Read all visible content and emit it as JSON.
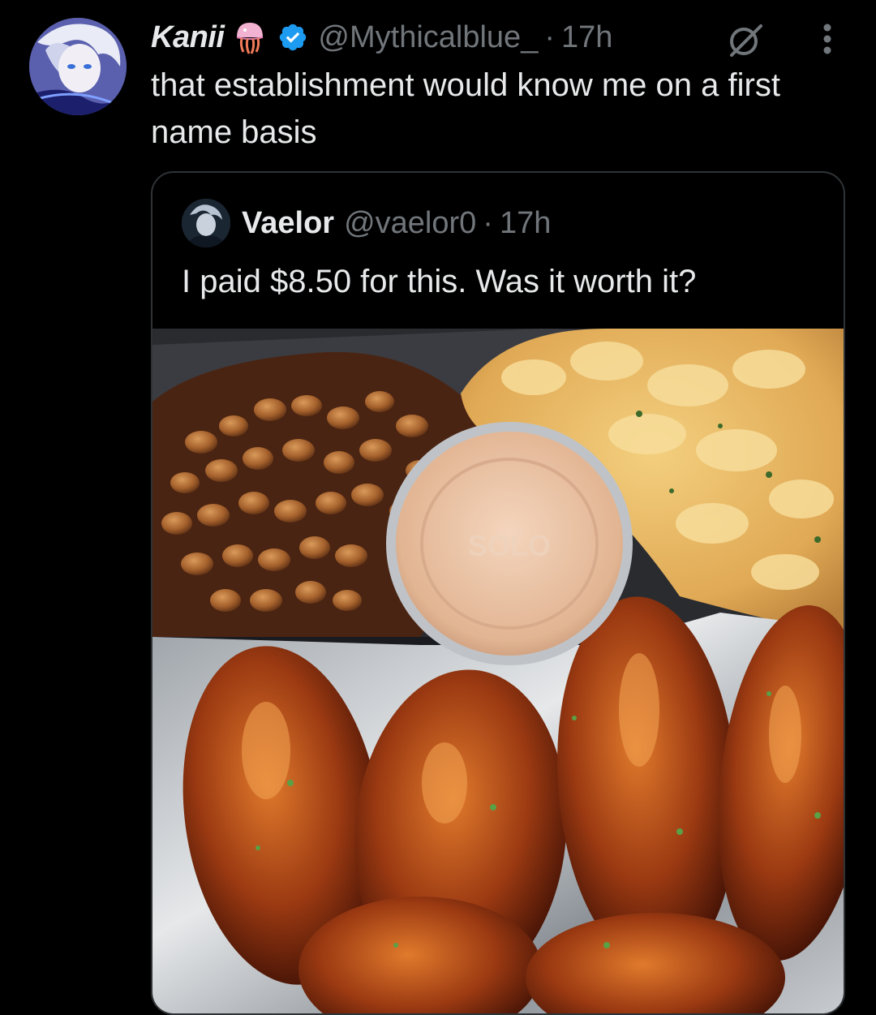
{
  "tweet": {
    "display_name": "Kanii",
    "handle": "@Mythicalblue_",
    "separator": "·",
    "time": "17h",
    "text": "that establishment would know me on a first name basis",
    "name_emoji": "jellyfish-emoji",
    "verified_color": "#1d9bf0"
  },
  "quoted_tweet": {
    "display_name": "Vaelor",
    "handle": "@vaelor0",
    "separator": "·",
    "time": "17h",
    "text": "I paid $8.50 for this. Was it worth it?",
    "media": {
      "cup_lid_text": "SOLO"
    }
  },
  "icons": {
    "grok": "grok-icon",
    "more": "more-vertical-icon"
  },
  "colors": {
    "background": "#000000",
    "primary_text": "#e7e9ea",
    "secondary_text": "#71767b",
    "border": "#2f3336"
  }
}
